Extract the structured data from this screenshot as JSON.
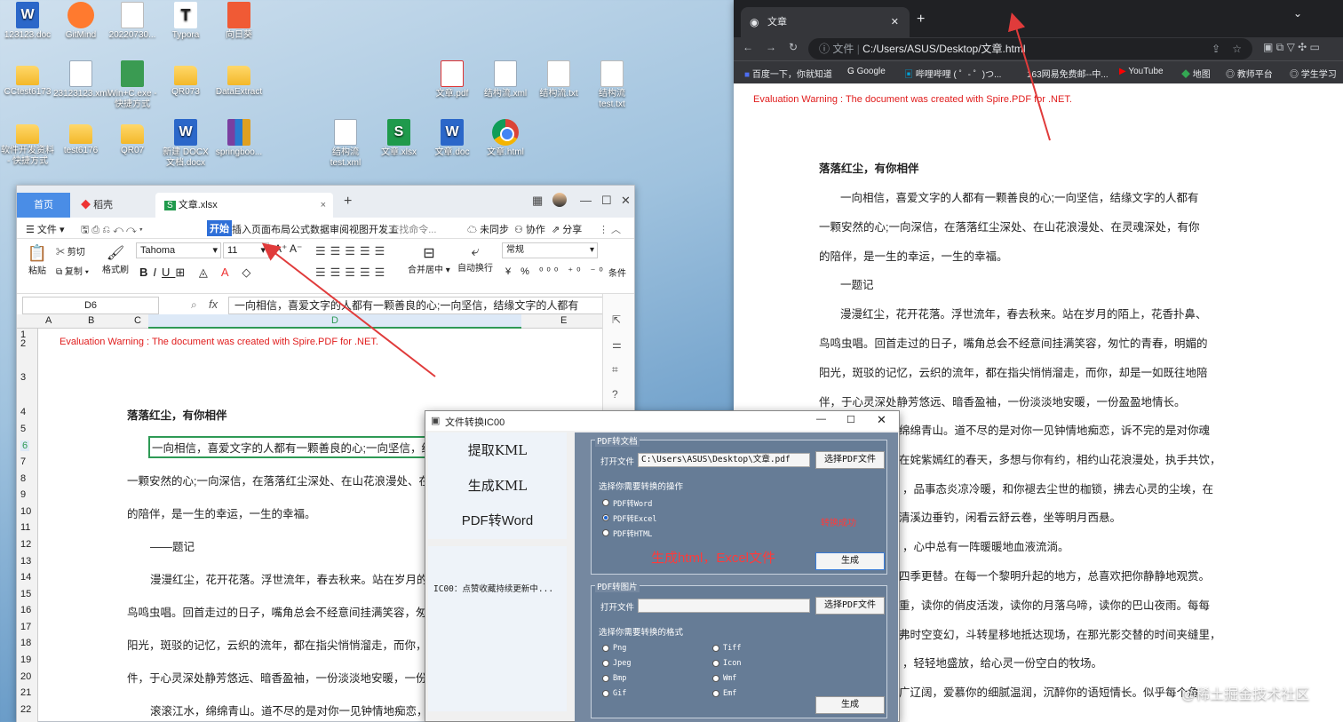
{
  "desktop": {
    "icons": [
      {
        "label": "123123.doc"
      },
      {
        "label": "GitMind"
      },
      {
        "label": "20220730..."
      },
      {
        "label": "Typora"
      },
      {
        "label": "向日葵"
      },
      {
        "label": "CCtest6173"
      },
      {
        "label": "23123123.xml"
      },
      {
        "label": "Win+C.exe - 快捷方式"
      },
      {
        "label": "QR073"
      },
      {
        "label": "DataExtract"
      },
      {
        "label": "文章.pdf"
      },
      {
        "label": "结构流.xml"
      },
      {
        "label": "结构流.txt"
      },
      {
        "label": "结构流 test.txt"
      },
      {
        "label": "软件开发资料 - 快捷方式"
      },
      {
        "label": "test6176"
      },
      {
        "label": "QR07"
      },
      {
        "label": "新建 DOCX 文档.docx"
      },
      {
        "label": "springboo..."
      },
      {
        "label": "结构流 test.xml"
      },
      {
        "label": "文章.xlsx"
      },
      {
        "label": "文章.doc"
      },
      {
        "label": "文章.html"
      }
    ],
    "watermark": "@稀土掘金技术社区"
  },
  "wps": {
    "tabs": {
      "home": "首页",
      "daoke": "稻壳",
      "file": "文章.xlsx"
    },
    "menu": {
      "file": "文件",
      "start": "开始",
      "ribbon_tabs": "插入页面布局公式数据审阅视图开发工",
      "search": "查找命令...",
      "sync": "未同步",
      "collab": "协作",
      "share": "分享"
    },
    "ribbon": {
      "paste": "粘贴",
      "cut": "剪切",
      "copy": "复制",
      "format_painter": "格式刷",
      "font": "Tahoma",
      "size": "11",
      "merge": "合并居中",
      "wrap": "自动换行",
      "numfmt": "常规",
      "cond": "条件"
    },
    "namebox": "D6",
    "fx": "fx",
    "formula": "一向相信，喜爱文字的人都有一颗善良的心;一向坚信，结缘文字的人都有",
    "columns": [
      "A",
      "B",
      "C",
      "D",
      "E"
    ],
    "rows": [
      "1",
      "2",
      "3",
      "4",
      "5",
      "6",
      "7",
      "8",
      "9",
      "10",
      "11",
      "12",
      "13",
      "14",
      "15",
      "16",
      "17",
      "18",
      "19",
      "20",
      "21",
      "22"
    ],
    "warning": "Evaluation Warning : The document was created with Spire.PDF for .NET.",
    "cells": [
      "落落红尘，有你相伴",
      "一向相信，喜爱文字的人都有一颗善良的心;一向坚信，结",
      "一颗安然的心;一向深信，在落落红尘深处、在山花浪漫处、在",
      "的陪伴，是一生的幸运，一生的幸福。",
      "——题记",
      "漫漫红尘，花开花落。浮世流年，春去秋来。站在岁月的",
      "鸟鸣虫唱。回首走过的日子，嘴角总会不经意间挂满笑容，匆",
      "阳光，斑驳的记忆，云织的流年，都在指尖悄悄溜走，而你，",
      "件，于心灵深处静芳悠远、暗香盈袖，一份淡淡地安暖，一份",
      "滚滚江水，绵绵青山。道不尽的是对你一见钟情地痴恋，"
    ]
  },
  "browser": {
    "tab_title": "文章",
    "url_prefix": "文件",
    "url": "C:/Users/ASUS/Desktop/文章.html",
    "bookmarks": [
      "百度一下，你就知道",
      "Google",
      "哔哩哔哩 ( ゜- ゜)つ...",
      "163网易免费邮--中...",
      "YouTube",
      "地图",
      "教师平台",
      "学生学习"
    ],
    "warning": "Evaluation Warning : The document was created with Spire.PDF for .NET.",
    "lines": [
      "落落红尘，有你相伴",
      "一向相信，喜爱文字的人都有一颗善良的心;一向坚信，结缘文字的人都有",
      "一颗安然的心;一向深信，在落落红尘深处、在山花浪漫处、在灵魂深处，有你",
      "的陪伴，是一生的幸运，一生的幸福。",
      "一题记",
      "漫漫红尘，花开花落。浮世流年，春去秋来。站在岁月的陌上，花香扑鼻、",
      "鸟鸣虫唱。回首走过的日子，嘴角总会不经意间挂满笑容，匆忙的青春，明媚的",
      "阳光，斑驳的记忆，云织的流年，都在指尖悄悄溜走，而你，却是一如既往地陪",
      "伴，于心灵深处静芳悠远、暗香盈袖，一份淡淡地安暖，一份盈盈地情长。",
      "绵绵青山。道不尽的是对你一见钟情地痴恋，诉不完的是对你魂",
      "在姹紫嫣红的春天，多想与你有约，相约山花浪漫处，执手共饮，",
      "，品事态炎凉冷暖，和你褪去尘世的枷锁，拂去心灵的尘埃，在",
      "清溪边垂钓，闲看云舒云卷，坐等明月西悬。",
      "，心中总有一阵暖暖地血液流淌。",
      "四季更替。在每一个黎明升起的地方，总喜欢把你静静地观赏。",
      "重，读你的俏皮活泼，读你的月落乌啼，读你的巴山夜雨。每每",
      "弗时空变幻，斗转星移地抵达现场，在那光影交替的时间夹缝里，",
      "，轻轻地盛放，给心灵一份空白的牧场。",
      "广辽阔，爱慕你的细腻温润，沉醉你的语短情长。似乎每个角"
    ]
  },
  "converter": {
    "title": "文件转换IC00",
    "nav": [
      "提取KML",
      "生成KML",
      "PDF转Word"
    ],
    "footer": "IC00：点赞收藏持续更新中...",
    "group1": {
      "legend": "PDF转文档",
      "open_label": "打开文件",
      "path": "C:\\Users\\ASUS\\Desktop\\文章.pdf",
      "select_btn": "选择PDF文件",
      "op_label": "选择你需要转换的操作",
      "options": [
        "PDF转Word",
        "PDF转Excel",
        "PDF转HTML"
      ],
      "selected": "PDF转Excel",
      "status": "转换成功",
      "generate": "生成"
    },
    "annotation": "生成html，Excel文件",
    "group2": {
      "legend": "PDF转图片",
      "open_label": "打开文件",
      "path": "",
      "select_btn": "选择PDF文件",
      "fmt_label": "选择你需要转换的格式",
      "formats": [
        "Png",
        "Jpeg",
        "Bmp",
        "Gif",
        "Tiff",
        "Icon",
        "Wmf",
        "Emf"
      ],
      "generate": "生成"
    }
  },
  "colors": {
    "warning": "#e01c1c",
    "annotation": "#ff3a3a",
    "selection": "#2e9a55",
    "wps_accent": "#4a8de6"
  }
}
